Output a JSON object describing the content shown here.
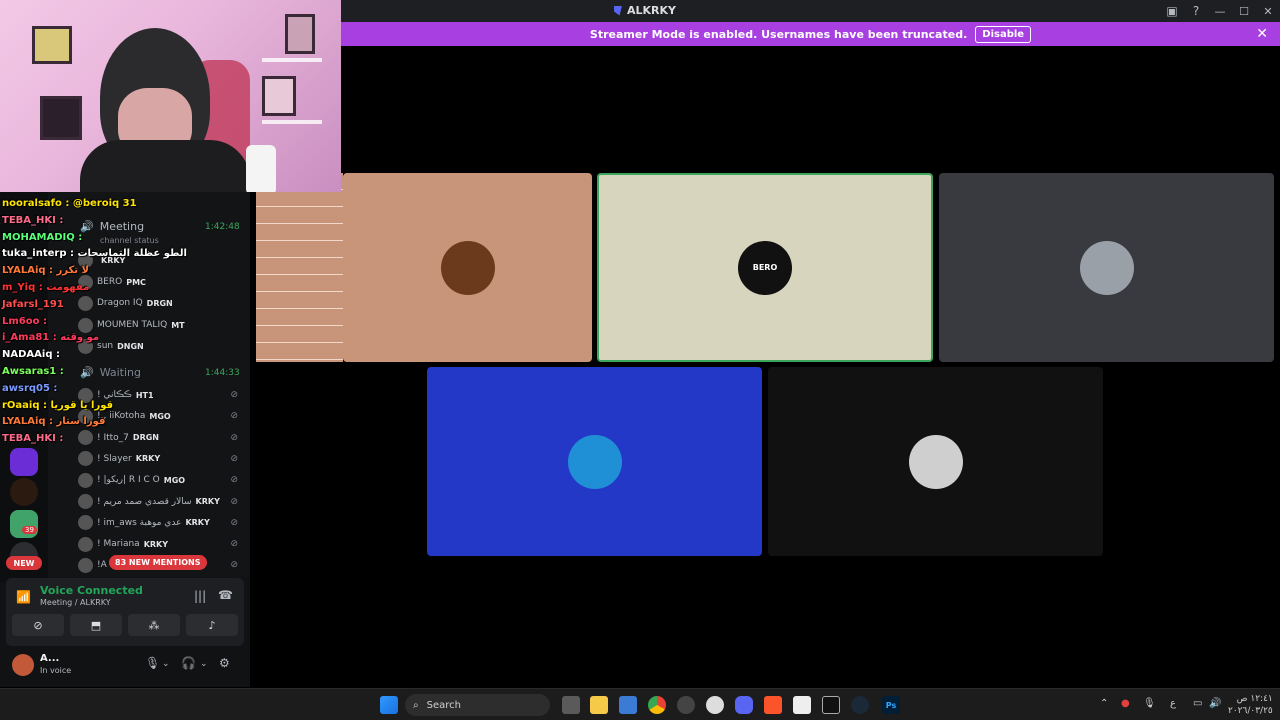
{
  "window": {
    "title": "ALKRKY"
  },
  "notice": {
    "message": "Streamer Mode is enabled. Usernames have been truncated.",
    "button": "Disable"
  },
  "voice_channels": {
    "meeting": {
      "label": "Meeting",
      "time": "1:42:48",
      "status": "channel status"
    },
    "waiting": {
      "label": "Waiting",
      "time": "1:44:33"
    }
  },
  "meeting_members": [
    {
      "name": "",
      "badge": "KRKY"
    },
    {
      "name": "BERO",
      "badge": "PMC"
    },
    {
      "name": "Dragon IQ",
      "badge": "DRGN"
    },
    {
      "name": "MOUMEN TALIQ",
      "badge": "MT"
    },
    {
      "name": "sun",
      "badge": "DNGN"
    }
  ],
  "waiting_members": [
    {
      "name": "! ڪڪاني",
      "badge": "HT1"
    },
    {
      "name": "! , iiKotoha",
      "badge": "MGO"
    },
    {
      "name": "! Itto_7",
      "badge": "DRGN"
    },
    {
      "name": "! Slayer",
      "badge": "KRKY"
    },
    {
      "name": "! |ريکو| R I C O",
      "badge": "MGO"
    },
    {
      "name": "! سالار قصدي صمد مريم",
      "badge": "KRKY"
    },
    {
      "name": "! im_aws عدي موهبة",
      "badge": "KRKY"
    },
    {
      "name": "! Mariana",
      "badge": "KRKY"
    },
    {
      "name": "!A",
      "badge": "DRG"
    }
  ],
  "chat": [
    {
      "text": "nooralsafo : @beroiq 31",
      "color": "#ffe400"
    },
    {
      "text": "TEBA_HKI :",
      "color": "#ff6b8a"
    },
    {
      "text": "MOHAMADIQ :",
      "color": "#5bff7a"
    },
    {
      "text": "tuka_interp : الطو عظلة التماسحات",
      "color": "#ffffff"
    },
    {
      "text": "LYALAiq : لا تكرر",
      "color": "#ff7a3a"
    },
    {
      "text": "m_Yiq : مفهومت",
      "color": "#ff3333"
    },
    {
      "text": "Jafarsl_191",
      "color": "#ff4f4f"
    },
    {
      "text": "Lm6oo :",
      "color": "#ff3b5c"
    },
    {
      "text": "i_Ama81 : مو وقته",
      "color": "#ff3b5c"
    },
    {
      "text": "NADAAiq :",
      "color": "#ffffff"
    },
    {
      "text": "Awsaras1 :",
      "color": "#7aff5b"
    },
    {
      "text": "awsrq05 :",
      "color": "#7a9bff"
    },
    {
      "text": "rOaaiq : قورا يا قوريا",
      "color": "#ffe400"
    },
    {
      "text": "LYALAiq : قورا ستار",
      "color": "#ff7a3a"
    },
    {
      "text": "TEBA_HKI :",
      "color": "#ff6b8a"
    }
  ],
  "mentions": "83 NEW MENTIONS",
  "new_badge": "NEW",
  "guild_count": "39",
  "voice": {
    "status": "Voice Connected",
    "channel": "Meeting / ALKRKY"
  },
  "user": {
    "name": "A...",
    "status": "In voice"
  },
  "tiles": [
    {
      "name": "tile-1",
      "bg": "#c9957a",
      "avatar_bg": "#6b3a1c",
      "label": ""
    },
    {
      "name": "tile-bero",
      "bg": "#d7d5be",
      "avatar_bg": "#111111",
      "label": "BERO"
    },
    {
      "name": "tile-3",
      "bg": "#383a40",
      "avatar_bg": "#9aa0a8",
      "label": ""
    },
    {
      "name": "tile-4",
      "bg": "#2438c7",
      "avatar_bg": "#1f8fd6",
      "label": ""
    },
    {
      "name": "tile-5",
      "bg": "#111111",
      "avatar_bg": "#cfcfcf",
      "label": ""
    }
  ],
  "taskbar": {
    "search": "Search",
    "lang": "ع",
    "time": "١٢:٤١ ص",
    "date": "٢٠٢٦/٠٣/٢٥"
  }
}
